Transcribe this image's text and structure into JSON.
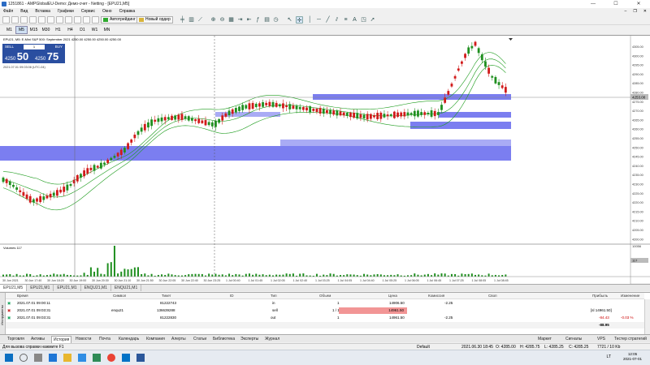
{
  "window": {
    "title": "1251861 - AMPGlobalEU-Demo: Демо-счет - Netting - [EPU21,M5]",
    "controls": [
      "—",
      "☐",
      "✕"
    ]
  },
  "menu": {
    "items": [
      "Файл",
      "Вид",
      "Вставка",
      "Графики",
      "Сервис",
      "Окно",
      "Справка"
    ]
  },
  "toolbar": {
    "autotrading_label": "Автотрейдинг",
    "new_order_label": "Новый ордер"
  },
  "timeframes": {
    "items": [
      "M1",
      "M5",
      "M15",
      "M30",
      "H1",
      "H4",
      "D1",
      "W1",
      "MN"
    ],
    "active": "M5"
  },
  "chart": {
    "header": "EPU21, M5:  E-Mini S&P 500: September 2021   4250.00 4250.00 4250.00 4250.00",
    "timestamp_overlay": "2021.07.01 09:03:06 (UTC-04)",
    "current_price_label": "4253.00",
    "volume_label": "Volumes 117",
    "volume_axis_top": "10056",
    "volume_axis_cur": "117",
    "price_axis": [
      "4305.00",
      "4300.00",
      "4295.00",
      "4290.00",
      "4285.00",
      "4280.00",
      "4275.00",
      "4270.00",
      "4265.00",
      "4260.00",
      "4255.00",
      "4250.00",
      "4245.00",
      "4240.00",
      "4235.00",
      "4230.00",
      "4225.00",
      "4220.00",
      "4215.00",
      "4210.00",
      "4205.00",
      "4200.00"
    ],
    "time_axis": [
      "30 Jun 2021",
      "30 Jun 17:40",
      "30 Jun 18:20",
      "30 Jun 19:00",
      "30 Jun 20:30",
      "30 Jun 21:10",
      "30 Jun 21:50",
      "30 Jun 22:05",
      "30 Jun 22:40",
      "30 Jun 23:25",
      "1 Jul 00:40",
      "1 Jul 01:45",
      "1 Jul 02:05",
      "1 Jul 02:40",
      "1 Jul 03:25",
      "1 Jul 04:05",
      "1 Jul 04:40",
      "1 Jul 05:25",
      "1 Jul 06:05",
      "1 Jul 06:45",
      "1 Jul 07:25",
      "1 Jul 08:05",
      "1 Jul 08:45"
    ],
    "colors": {
      "zone": "#7b7ef0",
      "zone_light": "#a9abf5",
      "candle_bull": "#1f8f1f",
      "candle_bear": "#d11a1a",
      "band": "#1b9b1b",
      "volume": "#1f8f1f"
    }
  },
  "one_click": {
    "sell_label": "SELL",
    "buy_label": "BUY",
    "lot": "1",
    "sell_big": "50",
    "sell_small": "4250",
    "buy_big": "75",
    "buy_small": "4250"
  },
  "chart_tabs": {
    "items": [
      "EPU21,M5",
      "EPU21,M1",
      "EPU21,M1",
      "ENQU21,M1",
      "ENQU21,M1"
    ],
    "active": 0
  },
  "terminal": {
    "side_label": "Инструменты",
    "headers": {
      "time": "Время",
      "symbol": "Символ",
      "ticket": "Тикет",
      "id": "ID",
      "type": "Тип",
      "volume": "Объем",
      "price": "Цена",
      "commission": "Комиссия",
      "swap": "Своп",
      "profit": "Прибыль",
      "change": "Изменение"
    },
    "rows": [
      {
        "time": "2021.07.01 09:00:11",
        "symbol": "",
        "ticket": "81222743",
        "type": "in",
        "volume": "1",
        "price": "14906.50",
        "commission": "-2.25",
        "swap": "",
        "profit": "",
        "change": ""
      },
      {
        "time": "2021.07.01 09:03:31",
        "symbol": "enqu21",
        "ticket": "136639288",
        "type": "sell",
        "volume": "1 / 1",
        "price": "14961.50",
        "commission": "",
        "swap": "",
        "profit": "[sl 14961.50]",
        "change": ""
      },
      {
        "time": "2021.07.01 09:03:31",
        "symbol": "",
        "ticket": "81222830",
        "type": "out",
        "volume": "1",
        "price": "14961.50",
        "commission": "-2.25",
        "swap": "",
        "profit": "-84.43",
        "change": "-0.03 %"
      }
    ],
    "total": "-88.95"
  },
  "terminal_tabs": {
    "items": [
      "Торговля",
      "Активы",
      "История",
      "Новости",
      "Почта",
      "Календарь",
      "Компания",
      "Алерты",
      "Статьи",
      "Библиотека",
      "Эксперты",
      "Журнал"
    ],
    "active": 2,
    "right": [
      "Маркет",
      "Сигналы",
      "VPS",
      "Тестер стратегий"
    ]
  },
  "status": {
    "help": "Для вызова справки нажмите F1",
    "profile": "Default",
    "datetime": "2021.06.30 18:45",
    "open": "O: 4285.00",
    "high": "H: 4285.75",
    "low": "L: 4285.25",
    "close": "C: 4285.25",
    "traffic": "7721 / 10 Kb"
  },
  "taskbar": {
    "lang": "LT",
    "time": "12:05",
    "date": "2021-07-01"
  }
}
